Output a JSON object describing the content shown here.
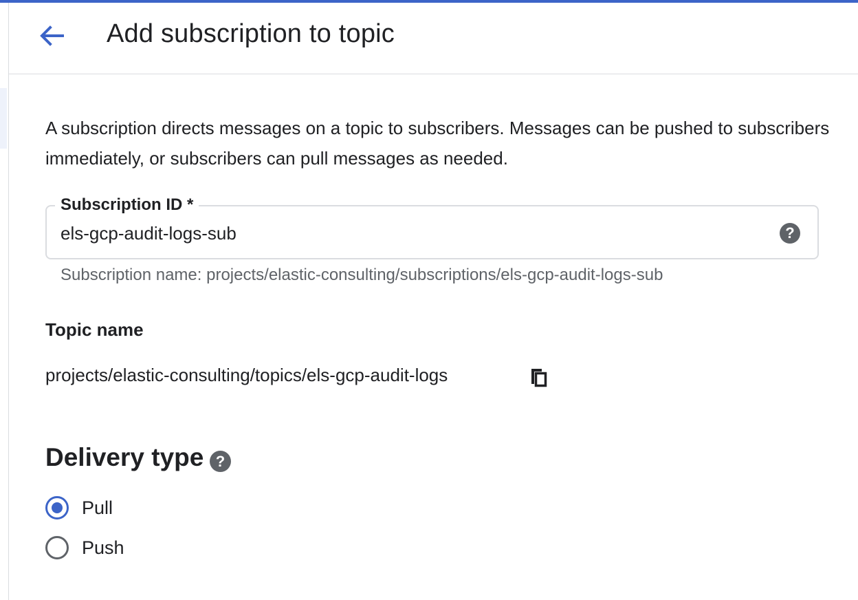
{
  "header": {
    "title": "Add subscription to topic",
    "back_icon": "arrow-left-icon"
  },
  "description": "A subscription directs messages on a topic to subscribers. Messages can be pushed to subscribers immediately, or subscribers can pull messages as needed.",
  "subscription_id": {
    "label": "Subscription ID *",
    "value": "els-gcp-audit-logs-sub",
    "help_icon": "help-icon",
    "help_glyph": "?",
    "hint": "Subscription name: projects/elastic-consulting/subscriptions/els-gcp-audit-logs-sub"
  },
  "topic": {
    "label": "Topic name",
    "value": "projects/elastic-consulting/topics/els-gcp-audit-logs",
    "copy_icon": "copy-icon"
  },
  "delivery": {
    "title": "Delivery type",
    "help_icon": "help-icon",
    "help_glyph": "?",
    "options": [
      {
        "label": "Pull",
        "selected": true
      },
      {
        "label": "Push",
        "selected": false
      }
    ]
  },
  "colors": {
    "accent": "#3c64c8",
    "text": "#202124",
    "secondary_text": "#5f6368",
    "border": "#dadce0"
  }
}
